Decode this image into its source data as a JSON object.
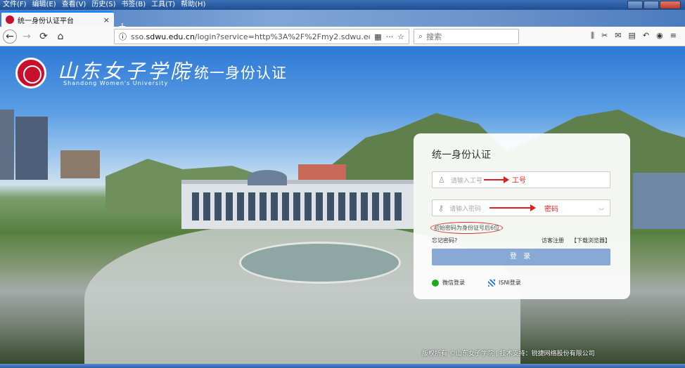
{
  "menu": [
    "文件(F)",
    "编辑(E)",
    "查看(V)",
    "历史(S)",
    "书签(B)",
    "工具(T)",
    "帮助(H)"
  ],
  "tab": {
    "title": "统一身份认证平台",
    "close": "×"
  },
  "toolbar": {
    "back": "←",
    "forward": "→",
    "reload": "⟳",
    "home": "⌂",
    "url_prefix": "sso.",
    "url_domain": "sdwu.edu.cn",
    "url_rest": "/login?service=http%3A%2F%2Fmy2.sdwu.ed",
    "search_placeholder": "搜索",
    "more": "···",
    "star": "☆"
  },
  "header": {
    "school_name": "山东女子学院",
    "school_name_en": "Shandong Women's University",
    "system_title": "统一身份认证"
  },
  "login": {
    "title": "统一身份认证",
    "username_placeholder": "请输入工号",
    "password_placeholder": "请输入密码",
    "username_annotation": "工号",
    "password_annotation": "密码",
    "password_hint": "初始密码为身份证号后6位",
    "forgot_password": "忘记密码?",
    "visitor_register": "访客注册",
    "download_browser": "【下载浏览器】",
    "login_button": "登 录",
    "wechat_login": "微信登录",
    "isni_login": "ISNI登录"
  },
  "footer": {
    "text": "版权所有 ©山东女子学院 | 技术支持：锐捷网络股份有限公司"
  },
  "colors": {
    "accent": "#0a84ff",
    "brand_red": "#c8102e",
    "login_button": "#87a9d3",
    "annotation_red": "#e02020"
  }
}
